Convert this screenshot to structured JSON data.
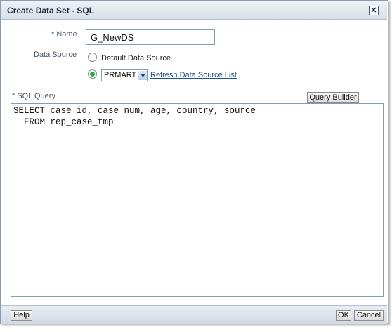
{
  "dialog": {
    "title": "Create Data Set - SQL",
    "close_icon": "close-icon",
    "close_glyph": "✕"
  },
  "form": {
    "name_label_required": "*",
    "name_label": "Name",
    "name_value": "G_NewDS",
    "datasource_label": "Data Source",
    "radio_default_label": "Default Data Source",
    "radio_default_selected": false,
    "radio_prmart_selected": true,
    "datasource_select_value": "PRMART",
    "refresh_link": "Refresh Data Source List",
    "sql_label_required": "*",
    "sql_label": "SQL Query",
    "query_builder_label": "Query Builder",
    "sql_lines": [
      "SELECT case_id, case_num, age, country, source",
      "  FROM rep_case_tmp"
    ]
  },
  "footer": {
    "help_label": "Help",
    "ok_label": "OK",
    "cancel_label": "Cancel"
  },
  "colors": {
    "title_bar": "#d8dfe9",
    "link": "#21508f",
    "radio_selected": "#2eaa3a",
    "border": "#7f9db9"
  }
}
